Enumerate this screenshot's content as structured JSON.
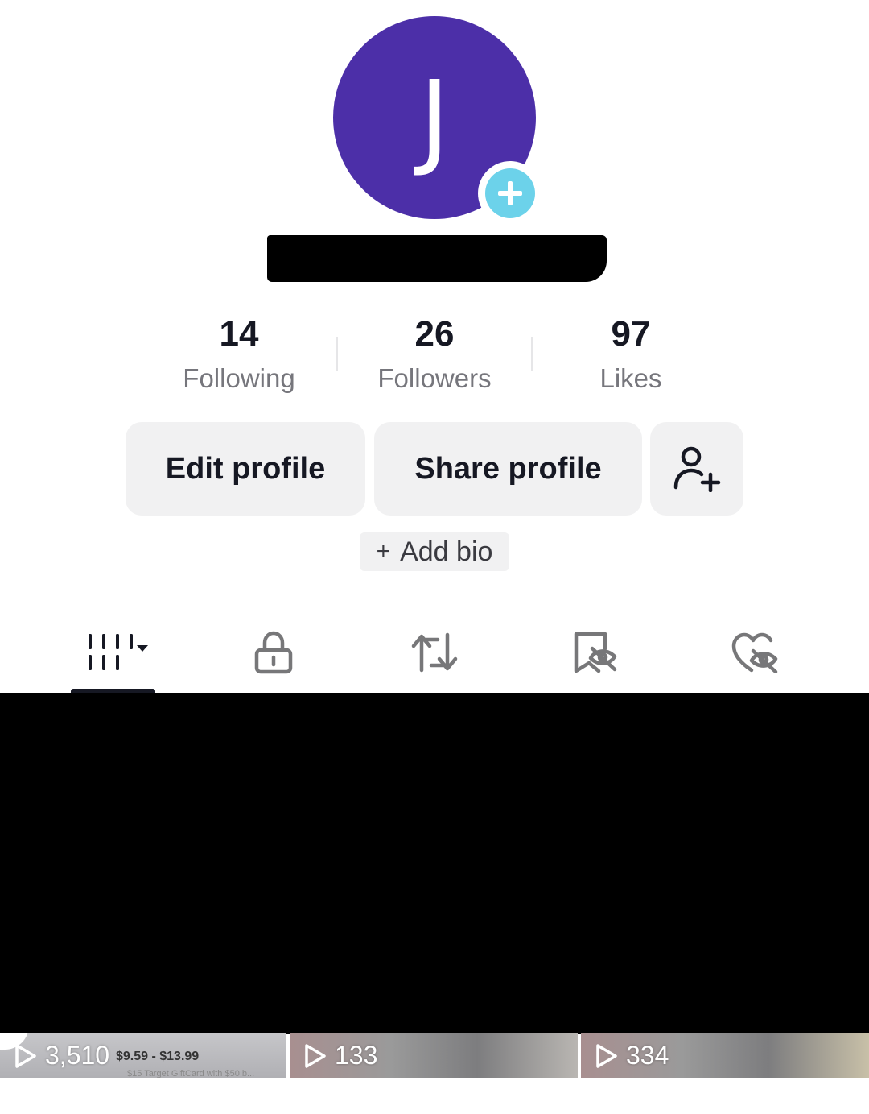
{
  "profile": {
    "avatar_initial": "J",
    "username": ""
  },
  "stats": [
    {
      "value": "14",
      "label": "Following"
    },
    {
      "value": "26",
      "label": "Followers"
    },
    {
      "value": "97",
      "label": "Likes"
    }
  ],
  "actions": {
    "edit_profile": "Edit profile",
    "share_profile": "Share profile"
  },
  "bio": {
    "add_bio_plus": "+",
    "add_bio_label": "Add bio"
  },
  "tabs": [
    {
      "icon": "videos-grid-icon"
    },
    {
      "icon": "lock-icon"
    },
    {
      "icon": "repost-icon"
    },
    {
      "icon": "bookmark-hidden-icon"
    },
    {
      "icon": "liked-hidden-icon"
    }
  ],
  "videos": [
    {
      "views": "3,510",
      "price": "$9.59 - $13.99",
      "price_note": "$15 Target GiftCard with $50 b..."
    },
    {
      "views": "133"
    },
    {
      "views": "334"
    }
  ],
  "colors": {
    "avatar_bg": "#4c2fa8",
    "add_badge": "#6cd2ea",
    "button_bg": "#f1f1f2",
    "text_primary": "#161823",
    "text_secondary": "#76767c"
  }
}
